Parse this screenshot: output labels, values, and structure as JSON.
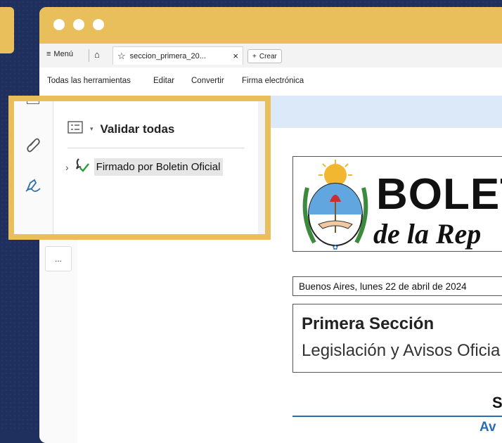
{
  "tabbar": {
    "menu_label": "Menú",
    "doc_tab_name": "seccion_primera_20...",
    "create_label": "Crear"
  },
  "toolbar": {
    "all_tools": "Todas las herramientas",
    "edit": "Editar",
    "convert": "Convertir",
    "esign": "Firma electrónica"
  },
  "signature_panel": {
    "validate_all": "Validar todas",
    "signed_by": "Firmado por Boletin Oficial"
  },
  "more_label": "...",
  "document": {
    "title": "BOLET",
    "subtitle": "de la Rep",
    "date": "Buenos Aires, lunes 22 de abril de 2024",
    "section_title": "Primera Sección",
    "section_subtitle": "Legislación y Avisos Oficia",
    "partial_heading": "S",
    "partial_link": "Av"
  },
  "colors": {
    "highlight": "#e9bf5c",
    "background": "#1f2f5e",
    "accent_blue": "#2a6db0",
    "check_green": "#2a9d3a"
  },
  "icons": [
    "hamburger-menu-icon",
    "home-icon",
    "star-icon",
    "close-icon",
    "plus-icon",
    "list-icon",
    "chevron-down-icon",
    "chevron-right-icon",
    "signature-check-icon",
    "paperclip-icon",
    "fill-sign-icon"
  ]
}
